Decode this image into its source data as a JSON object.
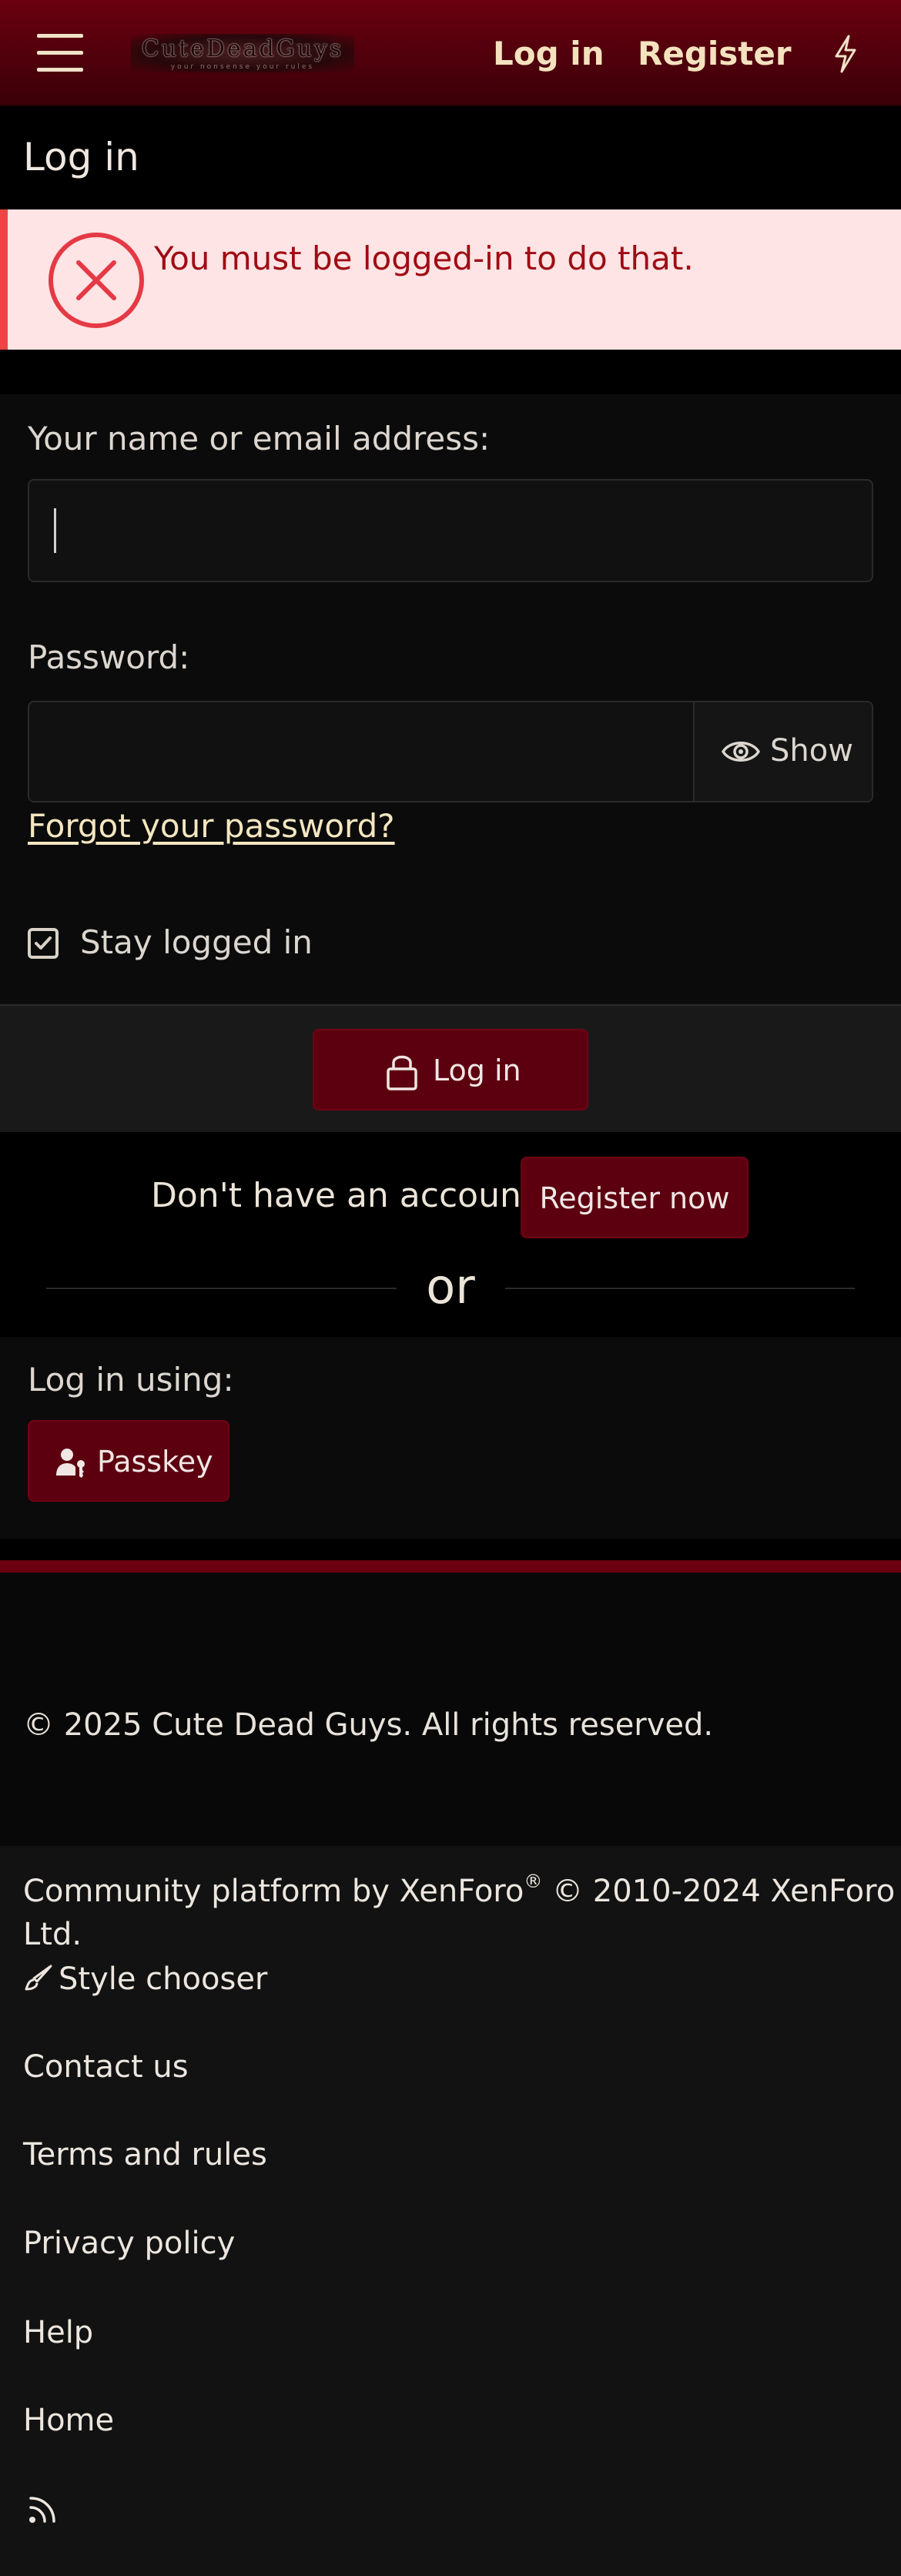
{
  "header": {
    "logo_text": "CuteDeadGuys",
    "logo_subtext": "your nonsense your rules",
    "login": "Log in",
    "register": "Register"
  },
  "page": {
    "title": "Log in"
  },
  "error": {
    "message": "You must be logged-in to do that."
  },
  "form": {
    "username_label": "Your name or email address:",
    "username_value": "",
    "password_label": "Password:",
    "password_value": "",
    "show_label": "Show",
    "forgot": "Forgot your password?",
    "stay_logged_in": "Stay logged in",
    "stay_logged_in_checked": true,
    "submit": "Log in"
  },
  "register_row": {
    "prompt": "Don't have an account?",
    "button": "Register now",
    "or": "or"
  },
  "alt_login": {
    "label": "Log in using:",
    "passkey": "Passkey"
  },
  "footer": {
    "copyright": "© 2025 Cute Dead Guys. All rights reserved.",
    "platform_prefix": "Community platform by XenForo",
    "platform_reg": "®",
    "platform_suffix": " © 2010-2024 XenForo Ltd.",
    "style_chooser": "Style chooser",
    "contact": "Contact us",
    "terms": "Terms and rules",
    "privacy": "Privacy policy",
    "help": "Help",
    "home": "Home"
  },
  "colors": {
    "header_red": "#6a0010",
    "button_red": "#5c0010",
    "error_bg": "#fee4e4",
    "error_accent": "#ef4444",
    "link_cream": "#f4e6c0"
  },
  "icons": [
    "menu-icon",
    "bolt-icon",
    "error-x-icon",
    "eye-icon",
    "check-icon",
    "lock-icon",
    "passkey-icon",
    "brush-icon",
    "rss-icon"
  ]
}
